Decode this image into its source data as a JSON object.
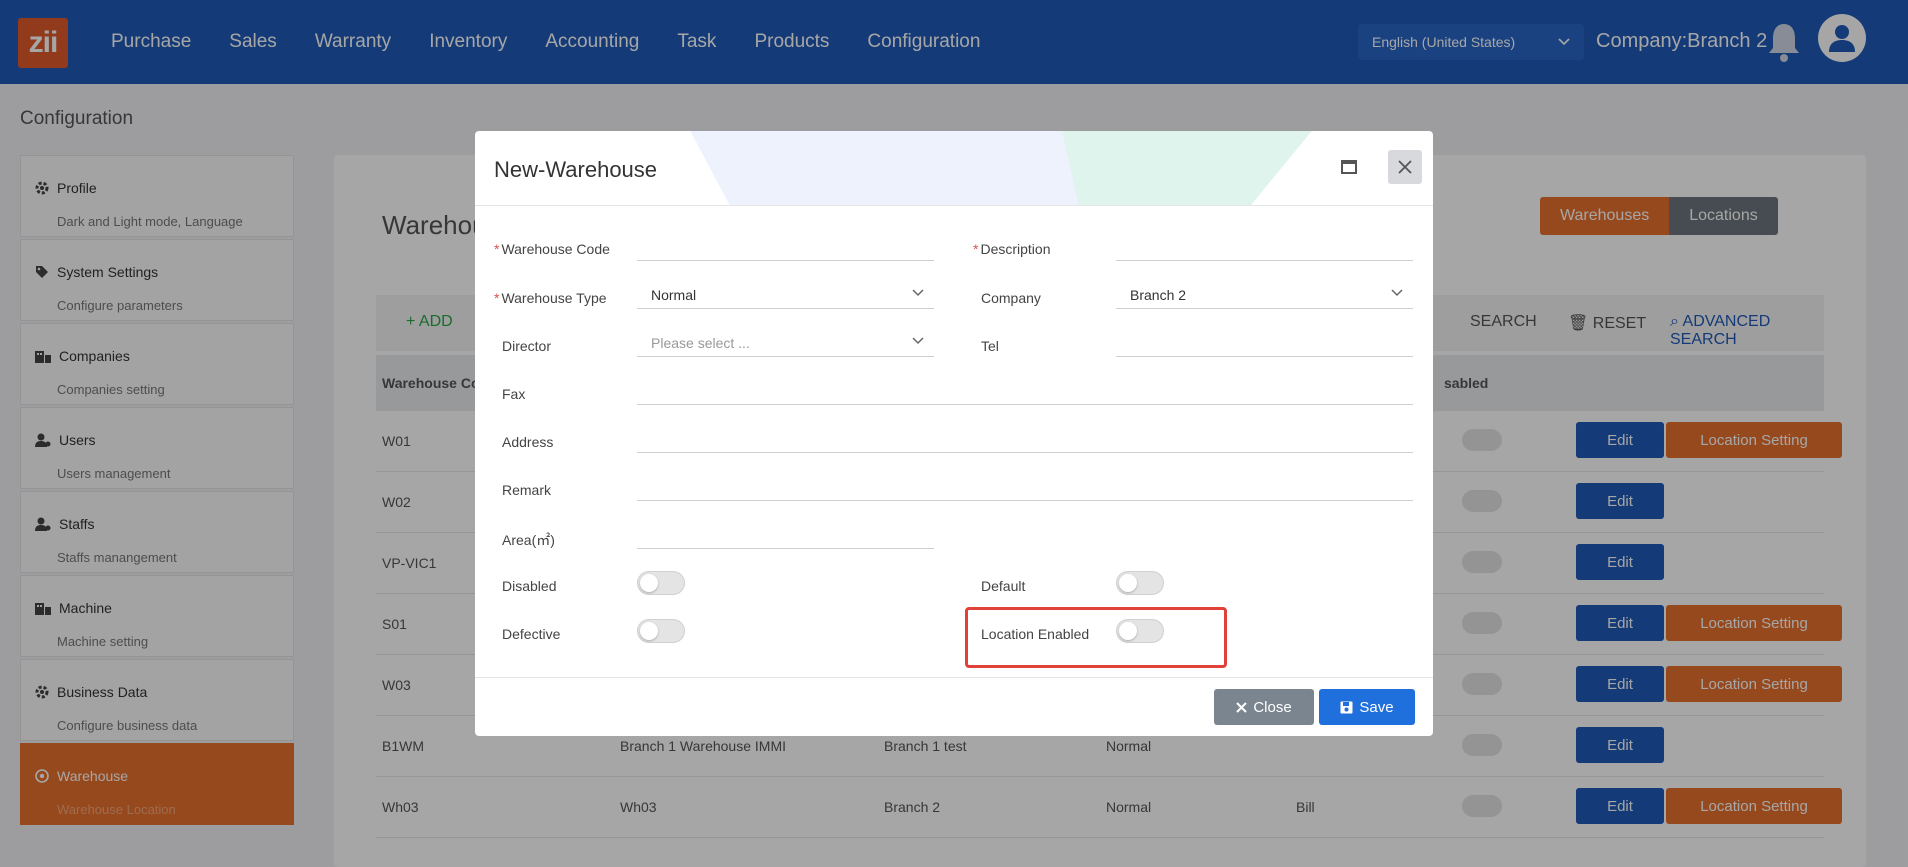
{
  "app": {
    "logo_text": "zii"
  },
  "nav": {
    "items": [
      "Purchase",
      "Sales",
      "Warranty",
      "Inventory",
      "Accounting",
      "Task",
      "Products",
      "Configuration"
    ]
  },
  "header": {
    "language": "English (United States)",
    "company": "Company:Branch 2"
  },
  "page": {
    "title": "Configuration"
  },
  "sidebar": {
    "items": [
      {
        "label": "Profile",
        "sub": "Dark and Light mode, Language",
        "icon": "gear-icon"
      },
      {
        "label": "System Settings",
        "sub": "Configure parameters",
        "icon": "tags-icon"
      },
      {
        "label": "Companies",
        "sub": "Companies setting",
        "icon": "building-icon"
      },
      {
        "label": "Users",
        "sub": "Users management",
        "icon": "user-cog-icon"
      },
      {
        "label": "Staffs",
        "sub": "Staffs manangement",
        "icon": "user-cog-icon"
      },
      {
        "label": "Machine",
        "sub": "Machine setting",
        "icon": "building-icon"
      },
      {
        "label": "Business Data",
        "sub": "Configure business data",
        "icon": "gear-icon"
      },
      {
        "label": "Warehouse",
        "sub": "Warehouse Location",
        "icon": "cog-circle-icon",
        "active": true
      }
    ]
  },
  "main": {
    "heading": "Warehou",
    "tabs": [
      "Warehouses",
      "Locations"
    ],
    "toolbar": {
      "add": "+ ADD",
      "search": "SEARCH",
      "reset": "RESET",
      "advanced": "ADVANCED SEARCH"
    },
    "columns": {
      "code": "Warehouse Co",
      "disabled": "sabled"
    },
    "rows": [
      {
        "code": "W01",
        "name": "",
        "company": "",
        "type": "",
        "director": "",
        "location_btn": true
      },
      {
        "code": "W02",
        "name": "",
        "company": "",
        "type": "",
        "director": "",
        "location_btn": false
      },
      {
        "code": "VP-VIC1",
        "name": "",
        "company": "",
        "type": "",
        "director": "",
        "location_btn": false
      },
      {
        "code": "S01",
        "name": "",
        "company": "",
        "type": "",
        "director": "",
        "location_btn": true
      },
      {
        "code": "W03",
        "name": "",
        "company": "",
        "type": "",
        "director": "",
        "location_btn": true
      },
      {
        "code": "B1WM",
        "name": "Branch 1 Warehouse IMMI",
        "company": "Branch 1 test",
        "type": "Normal",
        "director": "",
        "location_btn": false
      },
      {
        "code": "Wh03",
        "name": "Wh03",
        "company": "Branch 2",
        "type": "Normal",
        "director": "Bill",
        "location_btn": true
      }
    ],
    "edit_label": "Edit",
    "location_label": "Location Setting"
  },
  "modal": {
    "title": "New-Warehouse",
    "fields": {
      "warehouse_code": {
        "label": "Warehouse Code",
        "value": ""
      },
      "description": {
        "label": "Description",
        "value": ""
      },
      "warehouse_type": {
        "label": "Warehouse Type",
        "value": "Normal"
      },
      "company": {
        "label": "Company",
        "value": "Branch 2"
      },
      "director": {
        "label": "Director",
        "placeholder": "Please select ..."
      },
      "tel": {
        "label": "Tel",
        "value": ""
      },
      "fax": {
        "label": "Fax",
        "value": ""
      },
      "address": {
        "label": "Address",
        "value": ""
      },
      "remark": {
        "label": "Remark",
        "value": ""
      },
      "area": {
        "label": "Area(㎡)",
        "value": ""
      }
    },
    "toggles": {
      "disabled": {
        "label": "Disabled",
        "on": false
      },
      "default": {
        "label": "Default",
        "on": false
      },
      "defective": {
        "label": "Defective",
        "on": false
      },
      "location_enabled": {
        "label": "Location Enabled",
        "on": false
      }
    },
    "buttons": {
      "close": "Close",
      "save": "Save"
    }
  },
  "colors": {
    "nav_bg": "#1f5ab8",
    "accent_orange": "#e8702f",
    "primary_blue": "#1f6fdc",
    "highlight_red": "#e0423a"
  }
}
